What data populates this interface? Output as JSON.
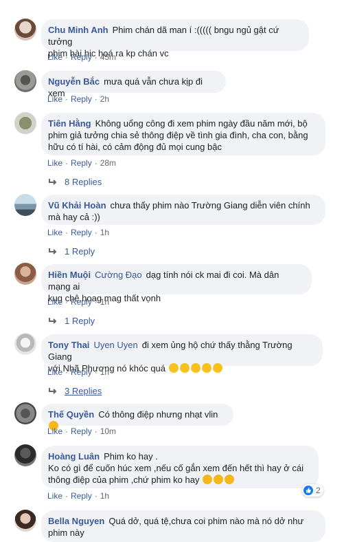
{
  "labels": {
    "like": "Like",
    "reply": "Reply",
    "dot": "·"
  },
  "colors": {
    "link": "#385898",
    "bubble": "#f0f2f5",
    "meta": "#606770",
    "like_blue": "#1877f2"
  },
  "comments": [
    {
      "name": "Chu Minh Anh",
      "text1": "Phim chán dã man í :((((( bngu ngủ gật cứ tưởng",
      "text2": "phim hài hic hoá ra kp chán vc",
      "time": "45m"
    },
    {
      "name": "Nguyễn Bắc",
      "text1": "mưa quá vẫn chưa kịp đi xem",
      "time": "2h"
    },
    {
      "name": "Tiên Hằng",
      "text1": "Không uổng công đi xem phim ngày đầu năm mới, bộ",
      "text2": "phim giả tưởng chia sẻ thông điệp về tình gia đình, cha con, bằng",
      "text3": "hữu có tí hài, có cảm động đủ mọi cung bậc",
      "time": "28m",
      "replies": "8 Replies"
    },
    {
      "name": "Vũ Khải Hoàn",
      "text1": "chưa thấy phim nào Trường Giang diễn viên chính",
      "text2": "mà hay cả :))",
      "time": "1h",
      "replies": "1 Reply"
    },
    {
      "name": "Hiền Muội",
      "name2": "Cường Đạo",
      "text1": "dạg tính nói ck mai đi coi. Mà dân mạng ai",
      "text2": "kug chê.hoag mag thất vọnh",
      "time": "1h",
      "replies": "1 Reply"
    },
    {
      "name": "Tony Thai",
      "name2": "Uyen Uyen",
      "text1": "đi xem ủng hộ chứ thấy thằng Trường Giang",
      "text2": "với Nhã Phương nó khóc quá",
      "time": "1h",
      "replies": "3 Replies"
    },
    {
      "name": "Thế Quyền",
      "text1": "Có thông điệp nhưng nhạt vlin",
      "time": "10m"
    },
    {
      "name": "Hoàng Luân",
      "text1": "Phim ko hay .",
      "text2": "Ko có gì để cuốn húc xem ,nếu cố gắn xem đến hết thì hay ở cái",
      "text3": "thông điệp của phim ,chứ phim ko hay",
      "time": "1h",
      "reaction_count": "2"
    },
    {
      "name": "Bella Nguyen",
      "text1": "Quá dở, quá tệ,chưa coi phim nào mà nó dở như",
      "text2": "phim này"
    }
  ]
}
